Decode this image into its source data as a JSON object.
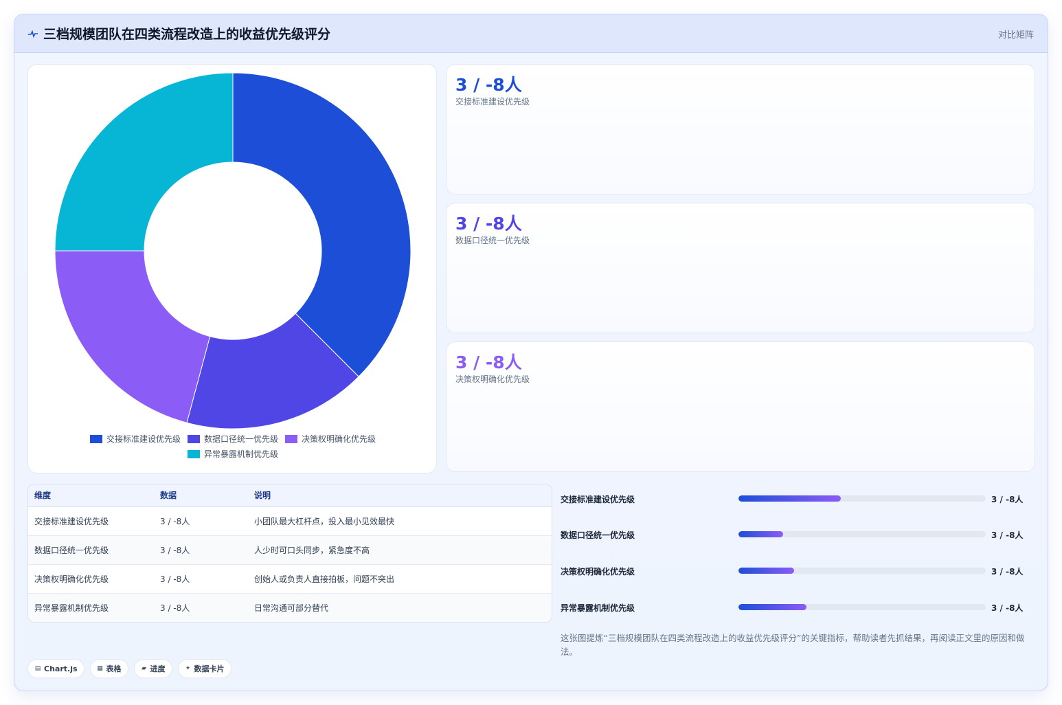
{
  "header": {
    "title": "三档规模团队在四类流程改造上的收益优先级评分",
    "tag": "对比矩阵",
    "logo_icon": "pulse-icon"
  },
  "kpis": [
    {
      "value": "3 / -8人",
      "label": "交接标准建设优先级",
      "color": "#1d4ed8"
    },
    {
      "value": "3 / -8人",
      "label": "数据口径统一优先级",
      "color": "#4f46e5"
    },
    {
      "value": "3 / -8人",
      "label": "决策权明确化优先级",
      "color": "#8b5cf6"
    }
  ],
  "table": {
    "headers": [
      "维度",
      "数据",
      "说明"
    ],
    "rows": [
      [
        "交接标准建设优先级",
        "3 / -8人",
        "小团队最大杠杆点，投入最小见效最快"
      ],
      [
        "数据口径统一优先级",
        "3 / -8人",
        "人少时可口头同步，紧急度不高"
      ],
      [
        "决策权明确化优先级",
        "3 / -8人",
        "创始人或负责人直接拍板，问题不突出"
      ],
      [
        "异常暴露机制优先级",
        "3 / -8人",
        "日常沟通可部分替代"
      ]
    ]
  },
  "progress": [
    {
      "label": "交接标准建设优先级",
      "value": "3 / -8人",
      "fraction": 0.415
    },
    {
      "label": "数据口径统一优先级",
      "value": "3 / -8人",
      "fraction": 0.18
    },
    {
      "label": "决策权明确化优先级",
      "value": "3 / -8人",
      "fraction": 0.225
    },
    {
      "label": "异常暴露机制优先级",
      "value": "3 / -8人",
      "fraction": 0.275
    }
  ],
  "note": "这张图提炼“三档规模团队在四类流程改造上的收益优先级评分”的关键指标，帮助读者先抓结果，再阅读正文里的原因和做法。",
  "chips": [
    {
      "icon": "chart-icon",
      "glyph": "▤",
      "label": "Chart.js"
    },
    {
      "icon": "table-icon",
      "glyph": "▦",
      "label": "表格"
    },
    {
      "icon": "progress-icon",
      "glyph": "▰",
      "label": "进度"
    },
    {
      "icon": "sparkle-icon",
      "glyph": "✦",
      "label": "数据卡片"
    }
  ],
  "chart_data": {
    "type": "pie",
    "variant": "doughnut",
    "categories": [
      "交接标准建设优先级",
      "数据口径统一优先级",
      "决策权明确化优先级",
      "异常暴露机制优先级"
    ],
    "values": [
      9,
      4,
      5,
      6
    ],
    "colors": [
      "#1d4ed8",
      "#4f46e5",
      "#8b5cf6",
      "#06b6d4"
    ],
    "legend": "bottom"
  }
}
